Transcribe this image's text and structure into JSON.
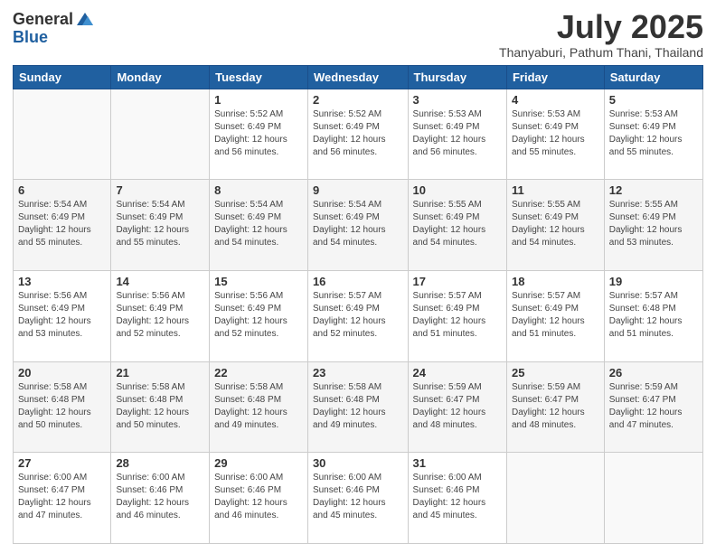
{
  "logo": {
    "general": "General",
    "blue": "Blue"
  },
  "header": {
    "month": "July 2025",
    "location": "Thanyaburi, Pathum Thani, Thailand"
  },
  "weekdays": [
    "Sunday",
    "Monday",
    "Tuesday",
    "Wednesday",
    "Thursday",
    "Friday",
    "Saturday"
  ],
  "weeks": [
    [
      {
        "day": "",
        "sunrise": "",
        "sunset": "",
        "daylight": ""
      },
      {
        "day": "",
        "sunrise": "",
        "sunset": "",
        "daylight": ""
      },
      {
        "day": "1",
        "sunrise": "Sunrise: 5:52 AM",
        "sunset": "Sunset: 6:49 PM",
        "daylight": "Daylight: 12 hours and 56 minutes."
      },
      {
        "day": "2",
        "sunrise": "Sunrise: 5:52 AM",
        "sunset": "Sunset: 6:49 PM",
        "daylight": "Daylight: 12 hours and 56 minutes."
      },
      {
        "day": "3",
        "sunrise": "Sunrise: 5:53 AM",
        "sunset": "Sunset: 6:49 PM",
        "daylight": "Daylight: 12 hours and 56 minutes."
      },
      {
        "day": "4",
        "sunrise": "Sunrise: 5:53 AM",
        "sunset": "Sunset: 6:49 PM",
        "daylight": "Daylight: 12 hours and 55 minutes."
      },
      {
        "day": "5",
        "sunrise": "Sunrise: 5:53 AM",
        "sunset": "Sunset: 6:49 PM",
        "daylight": "Daylight: 12 hours and 55 minutes."
      }
    ],
    [
      {
        "day": "6",
        "sunrise": "Sunrise: 5:54 AM",
        "sunset": "Sunset: 6:49 PM",
        "daylight": "Daylight: 12 hours and 55 minutes."
      },
      {
        "day": "7",
        "sunrise": "Sunrise: 5:54 AM",
        "sunset": "Sunset: 6:49 PM",
        "daylight": "Daylight: 12 hours and 55 minutes."
      },
      {
        "day": "8",
        "sunrise": "Sunrise: 5:54 AM",
        "sunset": "Sunset: 6:49 PM",
        "daylight": "Daylight: 12 hours and 54 minutes."
      },
      {
        "day": "9",
        "sunrise": "Sunrise: 5:54 AM",
        "sunset": "Sunset: 6:49 PM",
        "daylight": "Daylight: 12 hours and 54 minutes."
      },
      {
        "day": "10",
        "sunrise": "Sunrise: 5:55 AM",
        "sunset": "Sunset: 6:49 PM",
        "daylight": "Daylight: 12 hours and 54 minutes."
      },
      {
        "day": "11",
        "sunrise": "Sunrise: 5:55 AM",
        "sunset": "Sunset: 6:49 PM",
        "daylight": "Daylight: 12 hours and 54 minutes."
      },
      {
        "day": "12",
        "sunrise": "Sunrise: 5:55 AM",
        "sunset": "Sunset: 6:49 PM",
        "daylight": "Daylight: 12 hours and 53 minutes."
      }
    ],
    [
      {
        "day": "13",
        "sunrise": "Sunrise: 5:56 AM",
        "sunset": "Sunset: 6:49 PM",
        "daylight": "Daylight: 12 hours and 53 minutes."
      },
      {
        "day": "14",
        "sunrise": "Sunrise: 5:56 AM",
        "sunset": "Sunset: 6:49 PM",
        "daylight": "Daylight: 12 hours and 52 minutes."
      },
      {
        "day": "15",
        "sunrise": "Sunrise: 5:56 AM",
        "sunset": "Sunset: 6:49 PM",
        "daylight": "Daylight: 12 hours and 52 minutes."
      },
      {
        "day": "16",
        "sunrise": "Sunrise: 5:57 AM",
        "sunset": "Sunset: 6:49 PM",
        "daylight": "Daylight: 12 hours and 52 minutes."
      },
      {
        "day": "17",
        "sunrise": "Sunrise: 5:57 AM",
        "sunset": "Sunset: 6:49 PM",
        "daylight": "Daylight: 12 hours and 51 minutes."
      },
      {
        "day": "18",
        "sunrise": "Sunrise: 5:57 AM",
        "sunset": "Sunset: 6:49 PM",
        "daylight": "Daylight: 12 hours and 51 minutes."
      },
      {
        "day": "19",
        "sunrise": "Sunrise: 5:57 AM",
        "sunset": "Sunset: 6:48 PM",
        "daylight": "Daylight: 12 hours and 51 minutes."
      }
    ],
    [
      {
        "day": "20",
        "sunrise": "Sunrise: 5:58 AM",
        "sunset": "Sunset: 6:48 PM",
        "daylight": "Daylight: 12 hours and 50 minutes."
      },
      {
        "day": "21",
        "sunrise": "Sunrise: 5:58 AM",
        "sunset": "Sunset: 6:48 PM",
        "daylight": "Daylight: 12 hours and 50 minutes."
      },
      {
        "day": "22",
        "sunrise": "Sunrise: 5:58 AM",
        "sunset": "Sunset: 6:48 PM",
        "daylight": "Daylight: 12 hours and 49 minutes."
      },
      {
        "day": "23",
        "sunrise": "Sunrise: 5:58 AM",
        "sunset": "Sunset: 6:48 PM",
        "daylight": "Daylight: 12 hours and 49 minutes."
      },
      {
        "day": "24",
        "sunrise": "Sunrise: 5:59 AM",
        "sunset": "Sunset: 6:47 PM",
        "daylight": "Daylight: 12 hours and 48 minutes."
      },
      {
        "day": "25",
        "sunrise": "Sunrise: 5:59 AM",
        "sunset": "Sunset: 6:47 PM",
        "daylight": "Daylight: 12 hours and 48 minutes."
      },
      {
        "day": "26",
        "sunrise": "Sunrise: 5:59 AM",
        "sunset": "Sunset: 6:47 PM",
        "daylight": "Daylight: 12 hours and 47 minutes."
      }
    ],
    [
      {
        "day": "27",
        "sunrise": "Sunrise: 6:00 AM",
        "sunset": "Sunset: 6:47 PM",
        "daylight": "Daylight: 12 hours and 47 minutes."
      },
      {
        "day": "28",
        "sunrise": "Sunrise: 6:00 AM",
        "sunset": "Sunset: 6:46 PM",
        "daylight": "Daylight: 12 hours and 46 minutes."
      },
      {
        "day": "29",
        "sunrise": "Sunrise: 6:00 AM",
        "sunset": "Sunset: 6:46 PM",
        "daylight": "Daylight: 12 hours and 46 minutes."
      },
      {
        "day": "30",
        "sunrise": "Sunrise: 6:00 AM",
        "sunset": "Sunset: 6:46 PM",
        "daylight": "Daylight: 12 hours and 45 minutes."
      },
      {
        "day": "31",
        "sunrise": "Sunrise: 6:00 AM",
        "sunset": "Sunset: 6:46 PM",
        "daylight": "Daylight: 12 hours and 45 minutes."
      },
      {
        "day": "",
        "sunrise": "",
        "sunset": "",
        "daylight": ""
      },
      {
        "day": "",
        "sunrise": "",
        "sunset": "",
        "daylight": ""
      }
    ]
  ]
}
